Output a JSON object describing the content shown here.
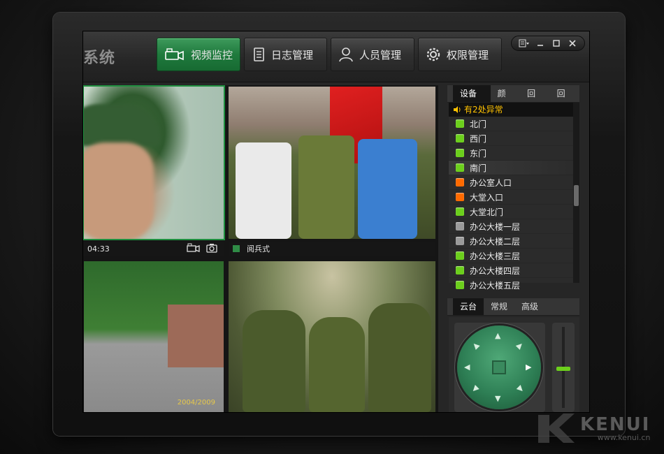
{
  "app": {
    "title": "系统"
  },
  "nav": [
    {
      "label": "视频监控",
      "icon": "camera-icon",
      "active": true
    },
    {
      "label": "日志管理",
      "icon": "document-icon",
      "active": false
    },
    {
      "label": "人员管理",
      "icon": "user-icon",
      "active": false
    },
    {
      "label": "权限管理",
      "icon": "gear-icon",
      "active": false
    }
  ],
  "window_controls": [
    "menu-icon",
    "minimize-icon",
    "maximize-icon",
    "close-icon"
  ],
  "videos": [
    {
      "time": "04:33",
      "label": ""
    },
    {
      "time": "",
      "label": "阅兵式"
    },
    {
      "time": "",
      "label": "",
      "stamp": "2004/2009"
    },
    {
      "time": "",
      "label": ""
    }
  ],
  "panel": {
    "tabs": [
      "设备表",
      "颜色",
      "回调",
      "回放"
    ],
    "alert": "有2处异常",
    "devices": [
      {
        "name": "北门",
        "status": "online"
      },
      {
        "name": "西门",
        "status": "online"
      },
      {
        "name": "东门",
        "status": "online"
      },
      {
        "name": "南门",
        "status": "online"
      },
      {
        "name": "办公室人口",
        "status": "alarm"
      },
      {
        "name": "大堂入口",
        "status": "alarm"
      },
      {
        "name": "大堂北门",
        "status": "online"
      },
      {
        "name": "办公大楼一层",
        "status": "offline"
      },
      {
        "name": "办公大楼二层",
        "status": "offline"
      },
      {
        "name": "办公大楼三层",
        "status": "online"
      },
      {
        "name": "办公大楼四层",
        "status": "online"
      },
      {
        "name": "办公大楼五层",
        "status": "online"
      }
    ],
    "ptz_tabs": [
      "云台",
      "常规",
      "高级"
    ]
  },
  "watermark": {
    "brand": "KENUI",
    "url": "www.kenui.cn"
  },
  "colors": {
    "accent": "#1f7a3d",
    "online": "#6ccf1c",
    "alarm": "#ff6a00",
    "offline": "#9a9a9a",
    "alert_text": "#ffc200"
  }
}
